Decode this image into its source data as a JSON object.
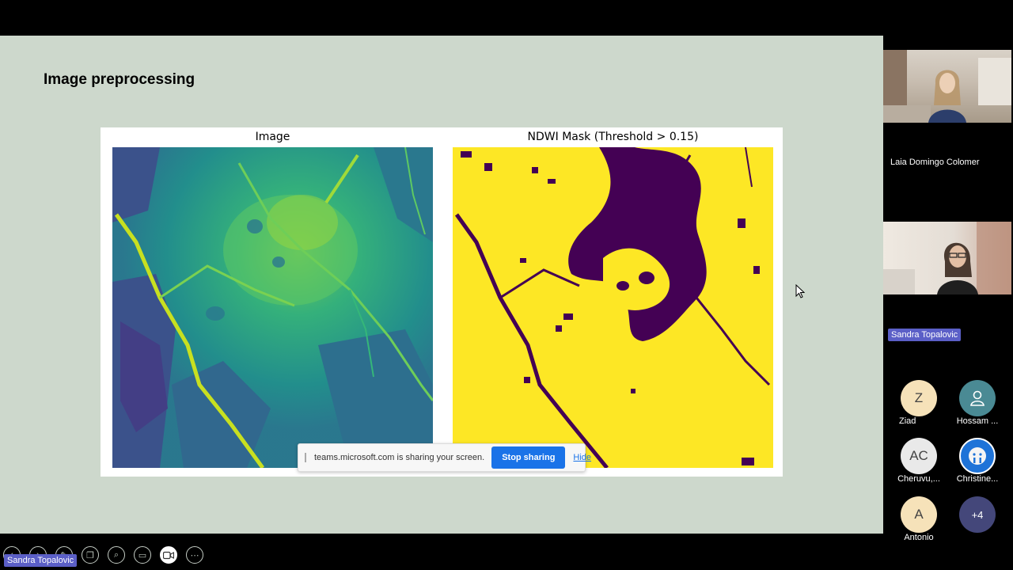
{
  "slide": {
    "title": "Image preprocessing",
    "figure": {
      "left_title": "Image",
      "right_title": "NDWI Mask (Threshold > 0.15)"
    }
  },
  "share_bar": {
    "text": "teams.microsoft.com is sharing your screen.",
    "stop_label": "Stop sharing",
    "hide_label": "Hide"
  },
  "controls": [
    {
      "icon": "back-icon"
    },
    {
      "icon": "forward-icon"
    },
    {
      "icon": "pen-icon"
    },
    {
      "icon": "copy-icon"
    },
    {
      "icon": "zoom-icon"
    },
    {
      "icon": "subtitles-icon"
    },
    {
      "icon": "video-camera-icon"
    },
    {
      "icon": "more-icon"
    }
  ],
  "participants": {
    "video_1_name": "Laia Domingo Colomer",
    "video_2_name": "Sandra Topalovic",
    "tiles": [
      {
        "initials": "Z",
        "label": "Ziad",
        "color": "#f6e2b9"
      },
      {
        "initials": "",
        "label": "Hossam ...",
        "color": "#4a8a94"
      },
      {
        "initials": "AC",
        "label": "Cheruvu,...",
        "color": "#e9e9e9"
      },
      {
        "initials": "",
        "label": "Christine...",
        "color": "#1e73d8"
      },
      {
        "initials": "A",
        "label": "Antonio",
        "color": "#f6e2b9"
      },
      {
        "initials": "+4",
        "label": "",
        "color": "#44477a"
      }
    ]
  },
  "presenter_label": "Sandra Topalovic",
  "colors": {
    "slide_bg": "#cdd8cc",
    "accent": "#1a73e8",
    "badge": "#5b5fc7",
    "mask_water": "#fde725",
    "mask_land": "#440154"
  }
}
